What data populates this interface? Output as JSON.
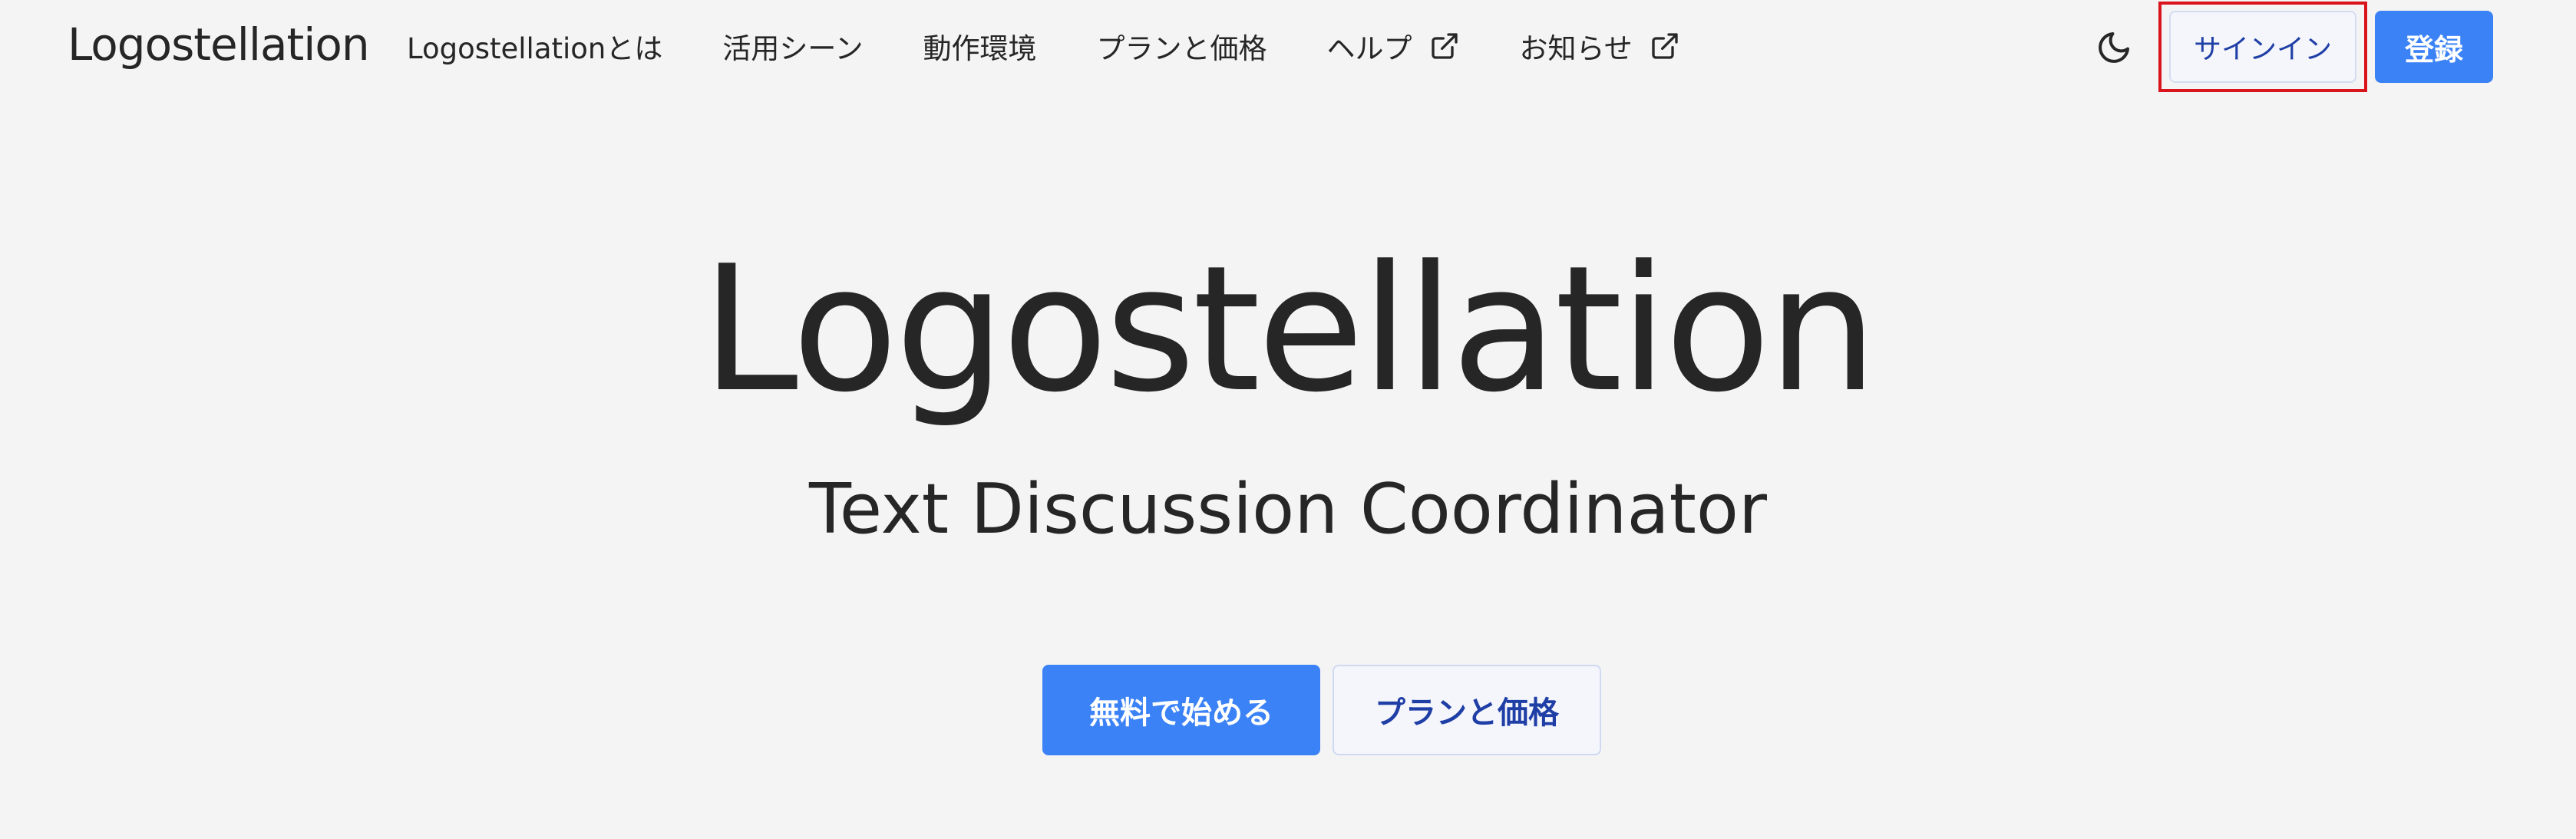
{
  "header": {
    "brand": "Logostellation",
    "nav": [
      {
        "label": "Logostellationとは"
      },
      {
        "label": "活用シーン"
      },
      {
        "label": "動作環境"
      },
      {
        "label": "プランと価格"
      },
      {
        "label": "ヘルプ",
        "icon": "external-link-icon"
      },
      {
        "label": "お知らせ",
        "icon": "external-link-icon"
      }
    ],
    "theme_toggle_icon": "moon-icon",
    "signin_label": "サインイン",
    "register_label": "登録"
  },
  "hero": {
    "title": "Logostellation",
    "subtitle": "Text Discussion Coordinator",
    "primary_cta": "無料で始める",
    "secondary_cta": "プランと価格"
  },
  "colors": {
    "background": "#f4f4f4",
    "accent": "#3b82f6",
    "link_text": "#1f3fa6",
    "highlight": "#d9141c"
  }
}
